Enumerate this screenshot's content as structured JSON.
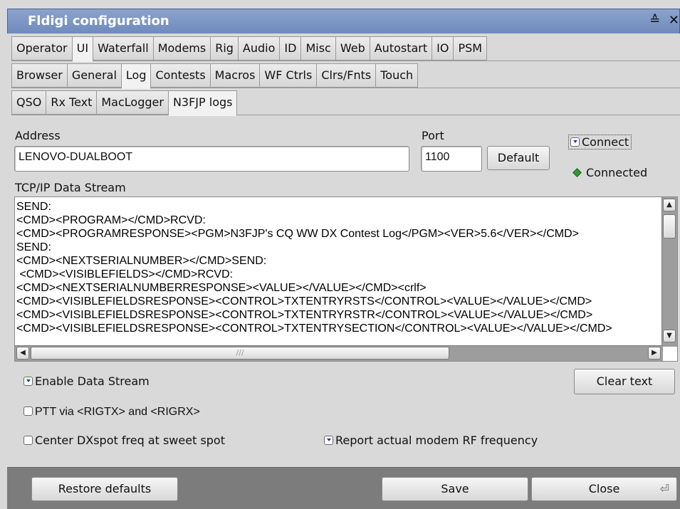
{
  "window": {
    "title": "Fldigi configuration",
    "controls": [
      "≙",
      "✕"
    ]
  },
  "tabs_level1": [
    "Operator",
    "UI",
    "Waterfall",
    "Modems",
    "Rig",
    "Audio",
    "ID",
    "Misc",
    "Web",
    "Autostart",
    "IO",
    "PSM"
  ],
  "tabs_level1_active": "UI",
  "tabs_level2": [
    "Browser",
    "General",
    "Log",
    "Contests",
    "Macros",
    "WF Ctrls",
    "Clrs/Fnts",
    "Touch"
  ],
  "tabs_level2_active": "Log",
  "tabs_level3": [
    "QSO",
    "Rx Text",
    "MacLogger",
    "N3FJP logs"
  ],
  "tabs_level3_active": "N3FJP logs",
  "address": {
    "label": "Address",
    "value": "LENOVO-DUALBOOT"
  },
  "port": {
    "label": "Port",
    "value": "1100"
  },
  "default_button": "Default",
  "connect": {
    "label": "Connect",
    "checked": true
  },
  "connected_status": "Connected",
  "stream": {
    "label": "TCP/IP Data Stream",
    "lines": [
      "SEND:",
      "<CMD><PROGRAM></CMD>RCVD:",
      "<CMD><PROGRAMRESPONSE><PGM>N3FJP's CQ WW DX Contest Log</PGM><VER>5.6</VER></CMD>",
      "SEND:",
      "<CMD><NEXTSERIALNUMBER></CMD>SEND:",
      " <CMD><VISIBLEFIELDS></CMD>RCVD:",
      "<CMD><NEXTSERIALNUMBERRESPONSE><VALUE></VALUE></CMD><crlf>",
      "<CMD><VISIBLEFIELDSRESPONSE><CONTROL>TXTENTRYRSTS</CONTROL><VALUE></VALUE></CMD>",
      "<CMD><VISIBLEFIELDSRESPONSE><CONTROL>TXTENTRYRSTR</CONTROL><VALUE></VALUE></CMD>",
      "<CMD><VISIBLEFIELDSRESPONSE><CONTROL>TXTENTRYSECTION</CONTROL><VALUE></VALUE></CMD>"
    ]
  },
  "options": {
    "enable_stream": {
      "label": "Enable Data Stream",
      "checked": true
    },
    "ptt": {
      "label": "PTT via <RIGTX> and <RIGRX>",
      "checked": false
    },
    "center_dx": {
      "label": "Center DXspot freq at sweet spot",
      "checked": false
    },
    "report_rf": {
      "label": "Report actual modem RF frequency",
      "checked": true
    }
  },
  "clear_text_button": "Clear text",
  "footer": {
    "restore": "Restore defaults",
    "save": "Save",
    "close": "Close"
  },
  "icons": [
    "shade-icon",
    "close-icon",
    "enter-icon",
    "scroll-up-icon",
    "scroll-down-icon",
    "scroll-left-icon",
    "scroll-right-icon"
  ]
}
